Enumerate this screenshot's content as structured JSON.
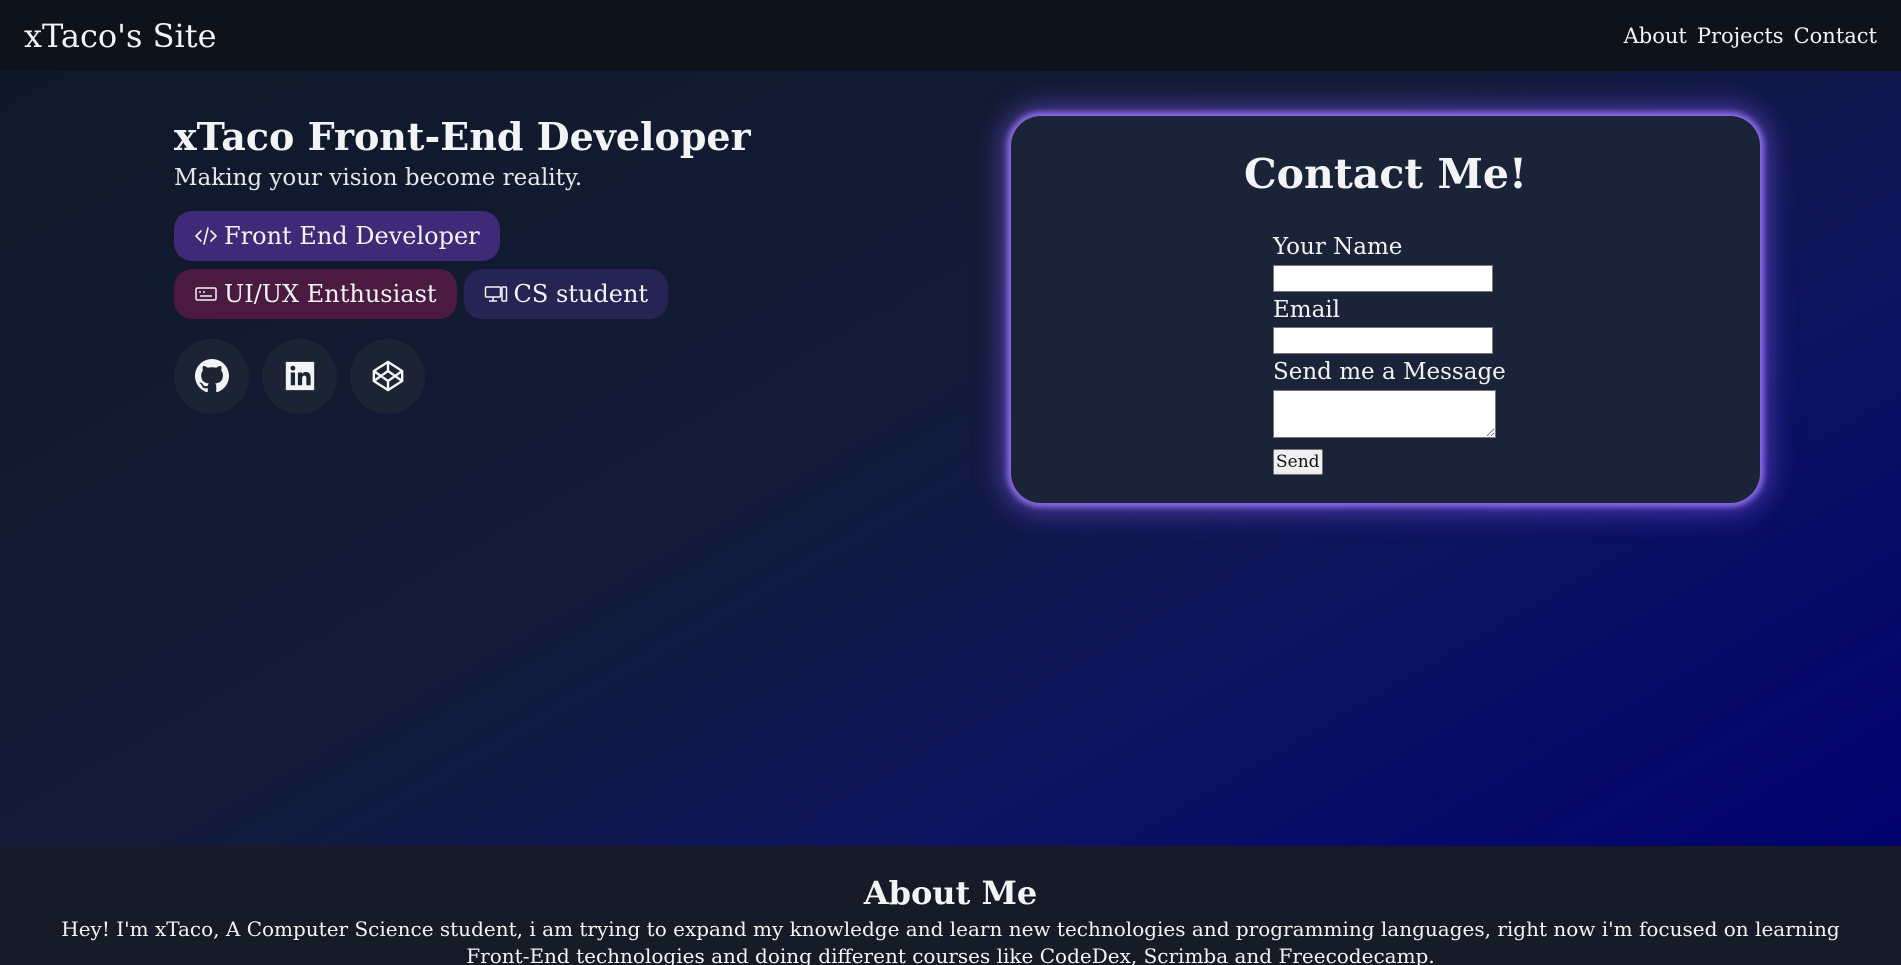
{
  "nav": {
    "title": "xTaco's Site",
    "links": [
      "About",
      "Projects",
      "Contact"
    ]
  },
  "hero": {
    "title": "xTaco Front-End Developer",
    "subtitle": "Making your vision become reality.",
    "badges": [
      {
        "label": "Front End Developer",
        "icon": "code-icon",
        "color": "#3f2a78"
      },
      {
        "label": "UI/UX Enthusiast",
        "icon": "keyboard-icon",
        "color": "#4a1a40"
      },
      {
        "label": "CS student",
        "icon": "computer-icon",
        "color": "#252455"
      }
    ],
    "socials": [
      "github-icon",
      "linkedin-icon",
      "codepen-icon"
    ]
  },
  "contact": {
    "title": "Contact Me!",
    "name_label": "Your Name",
    "name_value": "",
    "email_label": "Email",
    "email_value": "",
    "message_label": "Send me a Message",
    "message_value": "",
    "send_label": "Send",
    "glow_color": "#8b6ae6"
  },
  "about": {
    "title": "About Me",
    "text": "Hey! I'm xTaco, A Computer Science student, i am trying to expand my knowledge and learn new technologies and programming languages, right now i'm focused on learning Front-End technologies and doing different courses like CodeDex, Scrimba and Freecodecamp."
  }
}
